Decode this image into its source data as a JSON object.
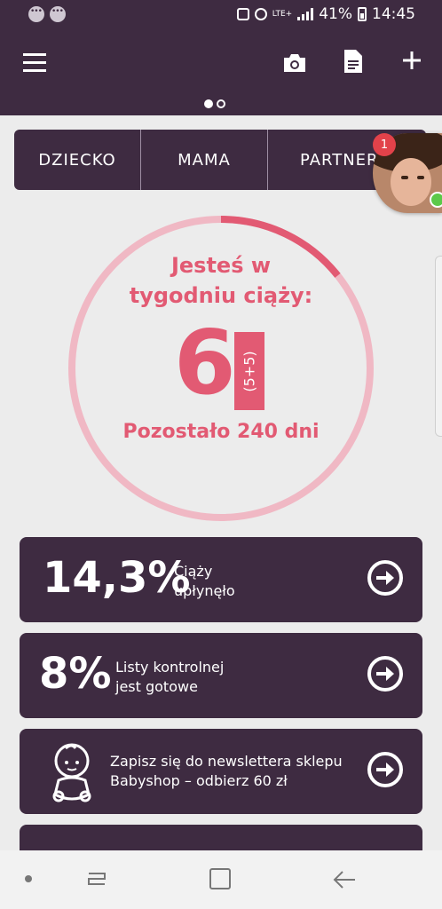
{
  "status_bar": {
    "network": "LTE+",
    "battery": "41%",
    "time": "14:45"
  },
  "tabs": [
    {
      "label": "DZIECKO"
    },
    {
      "label": "MAMA"
    },
    {
      "label": "PARTNER"
    }
  ],
  "notification_badge": "1",
  "pregnancy": {
    "title_line1": "Jesteś w",
    "title_line2": "tygodniu ciąży:",
    "week": "6",
    "week_detail": "(5+5)",
    "remaining": "Pozostało 240 dni",
    "progress_fraction": 0.143
  },
  "cards": [
    {
      "value": "14,3%",
      "text_line1": "Ciąży",
      "text_line2": "upłynęło"
    },
    {
      "value": "8%",
      "text_line1": "Listy kontrolnej",
      "text_line2": "jest gotowe"
    },
    {
      "text_line1": "Zapisz się do newslettera sklepu",
      "text_line2": "Babyshop – odbierz 60 zł"
    }
  ],
  "colors": {
    "primary": "#3e2b41",
    "accent": "#e25a73",
    "ring_track": "#f0b8c4",
    "badge": "#e2424a",
    "online": "#5cc94a"
  },
  "icons": [
    "menu-icon",
    "camera-icon",
    "document-icon",
    "plus-icon",
    "arrow-right-circle-icon",
    "baby-icon",
    "recent-apps-icon",
    "home-icon",
    "back-icon"
  ]
}
